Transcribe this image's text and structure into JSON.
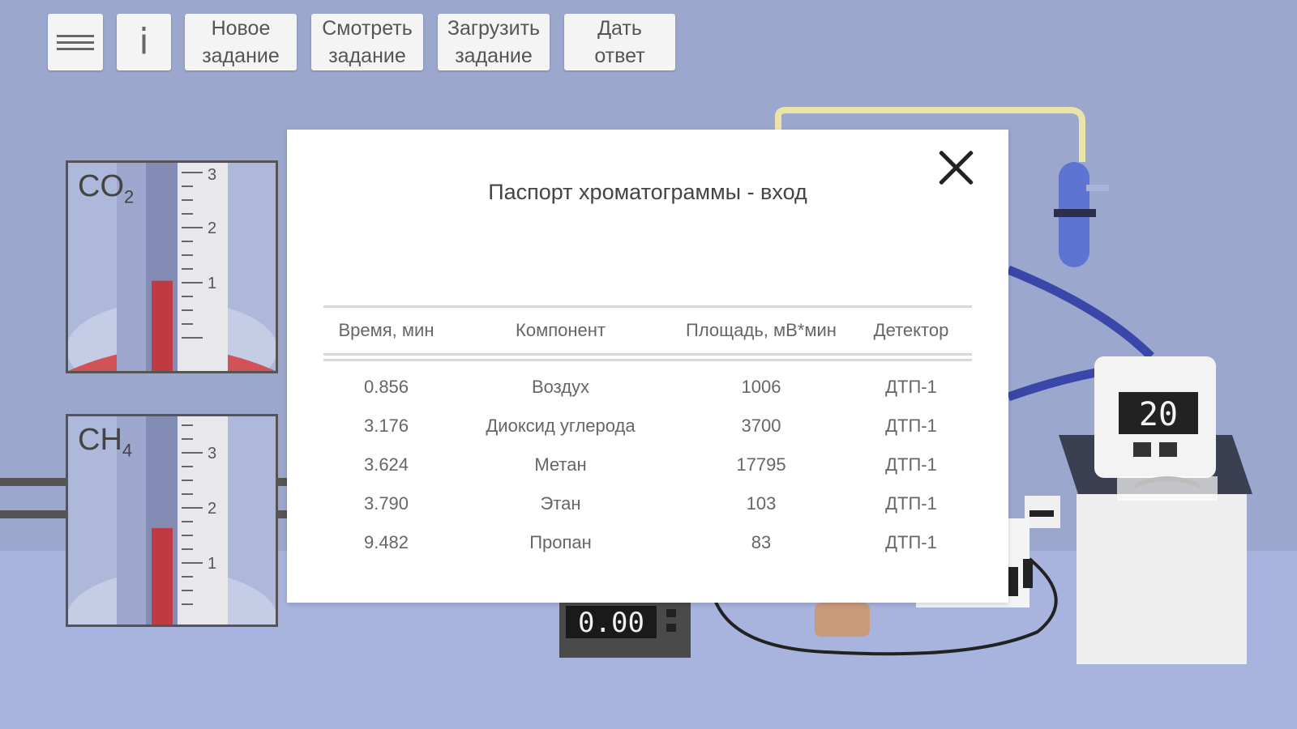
{
  "toolbar": {
    "menu_icon": "hamburger-icon",
    "info_label": "i",
    "new_task": "Новое\nзадание",
    "view_task": "Смотреть\nзадание",
    "load_task": "Загрузить\nзадание",
    "give_answer": "Дать\nответ"
  },
  "gauges": {
    "co2": {
      "formula": "CO",
      "sub": "2",
      "scale": [
        "3",
        "2",
        "1"
      ],
      "level_fraction": 0.34
    },
    "ch4": {
      "formula": "CH",
      "sub": "4",
      "scale": [
        "3",
        "2",
        "1"
      ],
      "level_fraction": 0.44
    }
  },
  "thermostat": {
    "display": "20"
  },
  "timer": {
    "display": "0.00"
  },
  "modal": {
    "title": "Паспорт хроматограммы - вход",
    "columns": [
      "Время, мин",
      "Компонент",
      "Площадь, мВ*мин",
      "Детектор"
    ],
    "rows": [
      [
        "0.856",
        "Воздух",
        "1006",
        "ДТП-1"
      ],
      [
        "3.176",
        "Диоксид углерода",
        "3700",
        "ДТП-1"
      ],
      [
        "3.624",
        "Метан",
        "17795",
        "ДТП-1"
      ],
      [
        "3.790",
        "Этан",
        "103",
        "ДТП-1"
      ],
      [
        "9.482",
        "Пропан",
        "83",
        "ДТП-1"
      ]
    ]
  },
  "colors": {
    "background": "#9aa6cc",
    "liquid": "#c8414c",
    "tube": "#3a46a8"
  }
}
